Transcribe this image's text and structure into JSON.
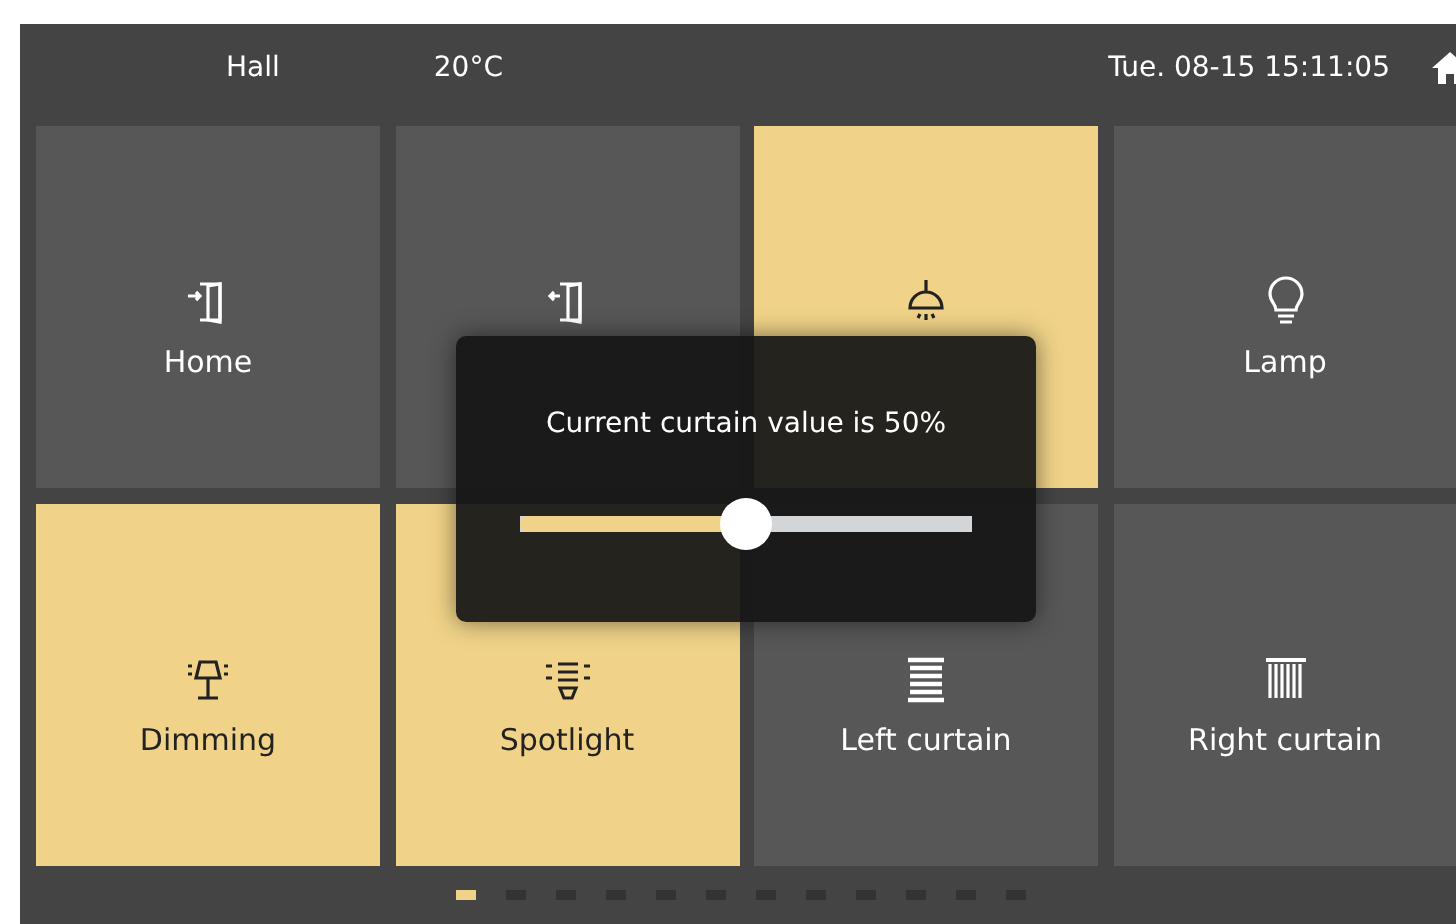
{
  "header": {
    "room": "Hall",
    "temperature": "20°C",
    "datetime": "Tue. 08-15 15:11:05"
  },
  "tiles": [
    {
      "label": "Home",
      "on": false
    },
    {
      "on": false
    },
    {
      "on": true
    },
    {
      "label": "Lamp",
      "on": false
    },
    {
      "label": "Dimming",
      "on": true
    },
    {
      "label": "Spotlight",
      "on": true
    },
    {
      "label": "Left curtain",
      "on": false
    },
    {
      "label": "Right curtain",
      "on": false
    }
  ],
  "dialog": {
    "message": "Current curtain value is 50%",
    "level": 0.5
  },
  "pages": [
    {
      "selected": true
    },
    {
      "selected": false
    },
    {
      "selected": false
    },
    {
      "selected": false
    },
    {
      "selected": false
    },
    {
      "selected": false
    },
    {
      "selected": false
    },
    {
      "selected": false
    },
    {
      "selected": false
    },
    {
      "selected": false
    },
    {
      "selected": false
    },
    {
      "selected": false
    }
  ]
}
